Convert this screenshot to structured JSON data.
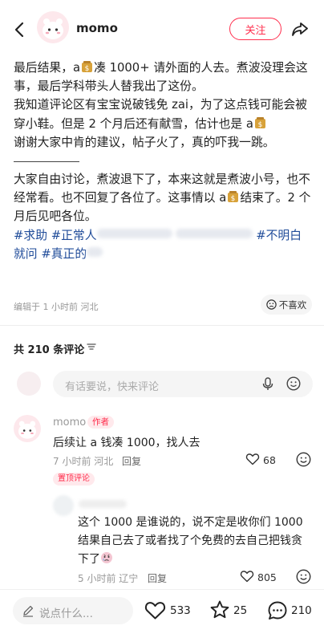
{
  "header": {
    "username": "momo",
    "follow_label": "关注"
  },
  "post": {
    "p1a": "最后结果，a",
    "p1b": "凑 1000+ 请外面的人去。煮波没理会这事，最后学科带头人替我出了这份。",
    "p2a": "我知道评论区有宝宝说破钱免 zai，为了这点钱可能会被穿小鞋。但是 2 个月后还有献雪，估计也是 a",
    "p3": "谢谢大家中肯的建议，帖子火了，真的吓我一跳。",
    "p4a": "大家自由讨论，煮波退下了，本来这就是煮波小号，也不经常看。也不回复了各位了。这事情以 a",
    "p4b": "结束了。2 个月后见吧各位。",
    "tags": {
      "t1": "#求助",
      "t2": "#正常人",
      "t3": "#不明白",
      "t4": "就问",
      "t5": "#真正的"
    },
    "edited": "编辑于 1 小时前 河北",
    "dislike_label": "不喜欢"
  },
  "comments_header": "共 210 条评论",
  "comment_input_placeholder": "有话要说，快来评论",
  "comments": [
    {
      "name": "momo",
      "badge": "作者",
      "text": "后续让 a 钱凑 1000，找人去",
      "time_loc": "7 小时前 河北",
      "reply": "回复",
      "likes": "68",
      "pinned": "置顶评论"
    },
    {
      "text": "这个 1000 是谁说的，说不定是收你们 1000 结果自己去了或者找了个免费的去自己把钱贪下了",
      "time_loc": "5 小时前 辽宁",
      "reply": "回复",
      "likes": "805"
    }
  ],
  "bottom": {
    "placeholder": "说点什么...",
    "likes": "533",
    "stars": "25",
    "comments": "210"
  },
  "colors": {
    "accent": "#ff2e4d",
    "tag": "#1f4b99"
  }
}
